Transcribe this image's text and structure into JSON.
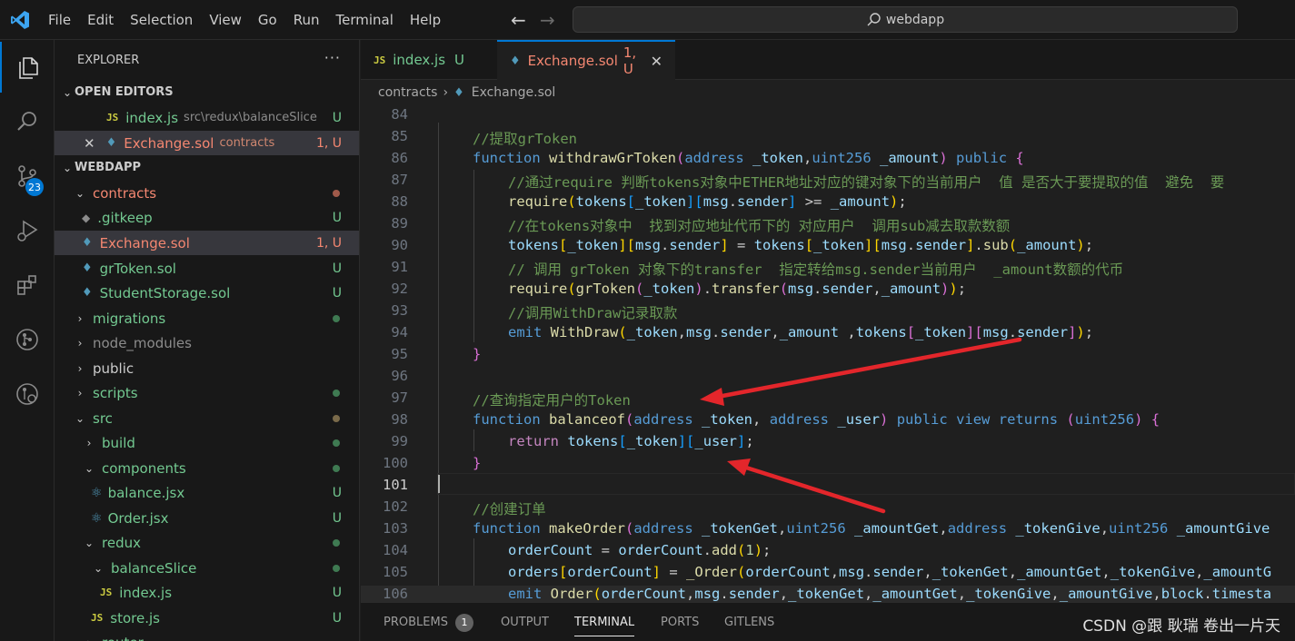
{
  "menu": [
    "File",
    "Edit",
    "Selection",
    "View",
    "Go",
    "Run",
    "Terminal",
    "Help"
  ],
  "search": {
    "text": "webdapp"
  },
  "activity": {
    "scm_badge": "23"
  },
  "explorer": {
    "title": "EXPLORER",
    "open_editors_label": "OPEN EDITORS",
    "open_editors": [
      {
        "name": "index.js",
        "desc": "src\\redux\\balanceSlice",
        "status": "U"
      },
      {
        "name": "Exchange.sol",
        "desc": "contracts",
        "status": "1, U"
      }
    ],
    "workspace_label": "WEBDAPP",
    "tree": {
      "contracts": "contracts",
      "gitkeep": ".gitkeep",
      "exchange": "Exchange.sol",
      "grtoken": "grToken.sol",
      "studentstorage": "StudentStorage.sol",
      "migrations": "migrations",
      "node_modules": "node_modules",
      "public": "public",
      "scripts": "scripts",
      "src": "src",
      "build": "build",
      "components": "components",
      "balance": "balance.jsx",
      "order": "Order.jsx",
      "redux": "redux",
      "balanceslice": "balanceSlice",
      "indexjs": "index.js",
      "storejs": "store.js",
      "router": "router"
    },
    "status": {
      "u": "U",
      "err": "1, U"
    }
  },
  "tabs": [
    {
      "icon": "JS",
      "label": "index.js",
      "status": "U"
    },
    {
      "icon": "sol",
      "label": "Exchange.sol",
      "status": "1, U"
    }
  ],
  "breadcrumb": {
    "folder": "contracts",
    "file": "Exchange.sol"
  },
  "editor": {
    "line_numbers": [
      "84",
      "85",
      "86",
      "87",
      "88",
      "89",
      "90",
      "91",
      "92",
      "93",
      "94",
      "95",
      "96",
      "97",
      "98",
      "99",
      "100",
      "101",
      "102",
      "103",
      "104",
      "105",
      "106"
    ],
    "current_line": "101"
  },
  "panel": {
    "tabs": [
      "PROBLEMS",
      "OUTPUT",
      "TERMINAL",
      "PORTS",
      "GITLENS"
    ],
    "problems_count": "1",
    "active": "TERMINAL"
  },
  "watermark": "CSDN @跟 耿瑞 卷出一片天",
  "colors": {
    "accent": "#0078d4",
    "untracked": "#73c991",
    "error": "#f48771",
    "arrow": "#e3262b"
  }
}
